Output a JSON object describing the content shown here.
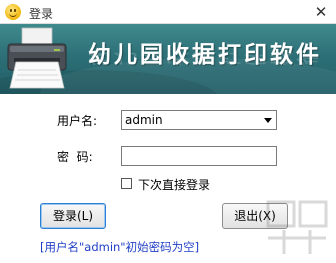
{
  "window": {
    "title": "登录",
    "close_symbol": "✕",
    "icon": "smiley-icon"
  },
  "banner": {
    "title": "幼儿园收据打印软件",
    "icon": "printer-icon",
    "colors": {
      "top": "#3f8a8d",
      "bottom": "#225d66"
    }
  },
  "form": {
    "username_label": "用户名:",
    "username_value": "admin",
    "password_label": "密  码:",
    "password_value": "",
    "remember_label": "下次直接登录",
    "remember_checked": false
  },
  "buttons": {
    "login_label": "登录(L)",
    "exit_label": "退出(X)"
  },
  "hint": {
    "text": "[用户名\"admin\"初始密码为空]",
    "color": "#1f3fc6"
  }
}
